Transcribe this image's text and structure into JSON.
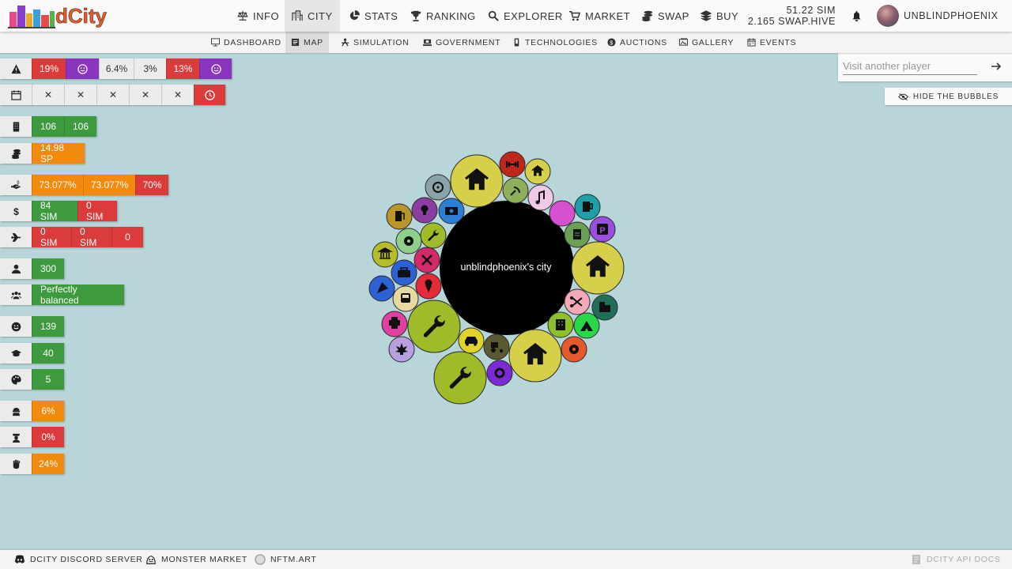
{
  "logo": {
    "text": "dCity"
  },
  "nav": [
    {
      "label": "INFO",
      "icon": "balance-scale-icon"
    },
    {
      "label": "CITY",
      "icon": "city-icon",
      "active": true
    },
    {
      "label": "STATS",
      "icon": "pie-chart-icon"
    },
    {
      "label": "RANKING",
      "icon": "trophy-icon"
    },
    {
      "label": "EXPLORER",
      "icon": "search-icon"
    },
    {
      "label": "MARKET",
      "icon": "cart-icon"
    },
    {
      "label": "SWAP",
      "icon": "coins-icon"
    },
    {
      "label": "BUY",
      "icon": "layers-icon"
    }
  ],
  "balances": {
    "sim": "51.22 SIM",
    "swap": "2.165 SWAP.HIVE"
  },
  "user": {
    "name": "UNBLINDPHOENIX"
  },
  "subnav": [
    {
      "label": "DASHBOARD",
      "icon": "monitor-icon"
    },
    {
      "label": "MAP",
      "icon": "map-icon",
      "active": true
    },
    {
      "label": "SIMULATION",
      "icon": "simulation-icon"
    },
    {
      "label": "GOVERNMENT",
      "icon": "government-icon"
    },
    {
      "label": "TECHNOLOGIES",
      "icon": "tech-icon"
    },
    {
      "label": "AUCTIONS",
      "icon": "auction-icon"
    },
    {
      "label": "GALLERY",
      "icon": "gallery-icon"
    },
    {
      "label": "EVENTS",
      "icon": "calendar-icon"
    }
  ],
  "stats": {
    "alerts": [
      "19%",
      "6.4%",
      "3%",
      "13%"
    ],
    "events": [
      "✕",
      "✕",
      "✕",
      "✕",
      "✕"
    ],
    "buildings": [
      "106",
      "106"
    ],
    "sp": "14.98 SP",
    "income_pct": [
      "73.077%",
      "73.077%",
      "70%"
    ],
    "sim": [
      "84 SIM",
      "0 SIM"
    ],
    "flights": [
      "0 SIM",
      "0 SIM",
      "0"
    ],
    "population": "300",
    "balance": "Perfectly balanced",
    "happiness": "139",
    "education": "40",
    "creativity": "5",
    "crime": "6%",
    "police": "0%",
    "protest": "24%"
  },
  "colors": {
    "red": "#dc3b3b",
    "green": "#3e9a3e",
    "orange": "#f28a0e",
    "purple": "#8a34c0",
    "map": "#b8d6d9"
  },
  "visit": {
    "placeholder": "Visit another player",
    "hide_label": "HIDE THE BUBBLES"
  },
  "city": {
    "label": "unblindphoenix's city"
  },
  "footer": {
    "discord": "DCITY DISCORD SERVER",
    "monster": "MONSTER MARKET",
    "nftm": "NFTM.ART",
    "api": "DCITY API DOCS"
  }
}
